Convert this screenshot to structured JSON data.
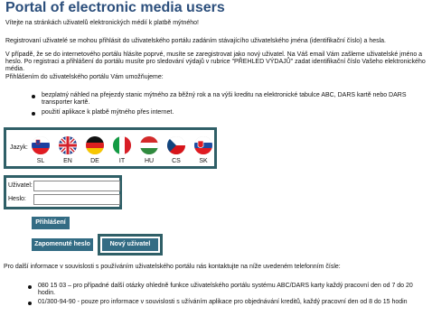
{
  "page": {
    "title": "Portal of electronic media users",
    "welcome": "Vítejte na stránkách uživatelů elektronických médií k platbě mýtného!",
    "para1": "Registrovaní uživatelé se mohou přihlásit do uživatelského portálu zadáním stávajícího uživatelského jména (identifikační číslo) a hesla.",
    "para2": "V případě, že se do internetového portálu hlásíte poprvé, musíte se zaregistrovat jako nový uživatel. Na Váš email Vám zašleme uživatelské jméno a heslo. Po registraci a přihlášení do portálu musíte pro sledování výdajů v rubrice \"PŘEHLED VÝDAJŮ\" zadat identifikační číslo Vašeho elektronického média.",
    "para3": "Přihlášením do uživatelského portálu Vám umožňujeme:",
    "features": [
      "bezplatný náhled na přejezdy stanic mýtného za běžný rok a na výši kreditu na elektronické tabulce ABC, DARS kartě nebo DARS transporter kartě.",
      "použití aplikace k platbě mýtného přes internet."
    ]
  },
  "language": {
    "label": "Jazyk:",
    "flags": [
      {
        "code": "SL",
        "icon": "slovenia-flag-icon"
      },
      {
        "code": "EN",
        "icon": "uk-flag-icon"
      },
      {
        "code": "DE",
        "icon": "germany-flag-icon"
      },
      {
        "code": "IT",
        "icon": "italy-flag-icon"
      },
      {
        "code": "HU",
        "icon": "hungary-flag-icon"
      },
      {
        "code": "CS",
        "icon": "czech-flag-icon"
      },
      {
        "code": "SK",
        "icon": "slovakia-flag-icon"
      }
    ]
  },
  "login": {
    "user_label": "Uživatel:",
    "user_value": "",
    "password_label": "Heslo:",
    "password_value": "",
    "login_button": "Přihlášení",
    "forgot_button": "Zapomenuté heslo",
    "new_user_button": "Nový uživatel"
  },
  "contact": {
    "intro": "Pro další informace v souvislosti s používáním uživatelského portálu nás kontaktujte na níže uvedeném telefonním čísle:",
    "items": [
      "080 15 03 – pro případné další otázky ohledně funkce uživatelského portálu systému ABC/DARS karty každý pracovní den od 7 do 20 hodin.",
      "01/300-94-90 - pouze pro informace v souvislosti s užíváním aplikace pro objednávání kreditů, každý pracovní den od 8 do 15 hodin"
    ]
  },
  "colors": {
    "title": "#2c4f7c",
    "button": "#336c84",
    "panel_border": "#2f5f67"
  }
}
